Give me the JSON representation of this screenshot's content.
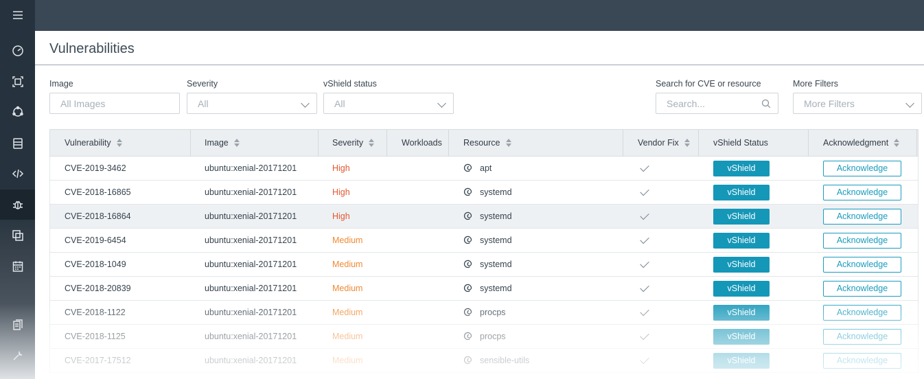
{
  "sidebar": {
    "items": [
      {
        "icon": "menu-icon"
      },
      {
        "icon": "dashboard-icon"
      },
      {
        "icon": "scan-icon"
      },
      {
        "icon": "cluster-icon"
      },
      {
        "icon": "database-icon"
      },
      {
        "icon": "code-icon"
      },
      {
        "icon": "bug-icon",
        "active": true
      },
      {
        "icon": "layers-icon"
      },
      {
        "icon": "calendar-icon"
      },
      {
        "icon": "report-icon"
      },
      {
        "icon": "wrench-icon"
      }
    ]
  },
  "page": {
    "title": "Vulnerabilities"
  },
  "filters": {
    "image": {
      "label": "Image",
      "placeholder": "All Images"
    },
    "severity": {
      "label": "Severity",
      "value": "All"
    },
    "vshield": {
      "label": "vShield status",
      "value": "All"
    },
    "search": {
      "label": "Search for CVE or resource",
      "placeholder": "Search..."
    },
    "more": {
      "label": "More Filters",
      "value": "More Filters"
    }
  },
  "table": {
    "columns": {
      "vulnerability": "Vulnerability",
      "image": "Image",
      "severity": "Severity",
      "workloads": "Workloads",
      "resource": "Resource",
      "vendor_fix": "Vendor Fix",
      "vshield_status": "vShield Status",
      "acknowledgment": "Acknowledgment"
    },
    "rows": [
      {
        "cve": "CVE-2019-3462",
        "image": "ubuntu:xenial-20171201",
        "severity": "High",
        "resource": "apt",
        "vshield": "vShield",
        "ack": "Acknowledge"
      },
      {
        "cve": "CVE-2018-16865",
        "image": "ubuntu:xenial-20171201",
        "severity": "High",
        "resource": "systemd",
        "vshield": "vShield",
        "ack": "Acknowledge"
      },
      {
        "cve": "CVE-2018-16864",
        "image": "ubuntu:xenial-20171201",
        "severity": "High",
        "resource": "systemd",
        "vshield": "vShield",
        "ack": "Acknowledge"
      },
      {
        "cve": "CVE-2019-6454",
        "image": "ubuntu:xenial-20171201",
        "severity": "Medium",
        "resource": "systemd",
        "vshield": "vShield",
        "ack": "Acknowledge"
      },
      {
        "cve": "CVE-2018-1049",
        "image": "ubuntu:xenial-20171201",
        "severity": "Medium",
        "resource": "systemd",
        "vshield": "vShield",
        "ack": "Acknowledge"
      },
      {
        "cve": "CVE-2018-20839",
        "image": "ubuntu:xenial-20171201",
        "severity": "Medium",
        "resource": "systemd",
        "vshield": "vShield",
        "ack": "Acknowledge"
      },
      {
        "cve": "CVE-2018-1122",
        "image": "ubuntu:xenial-20171201",
        "severity": "Medium",
        "resource": "procps",
        "vshield": "vShield",
        "ack": "Acknowledge"
      },
      {
        "cve": "CVE-2018-1125",
        "image": "ubuntu:xenial-20171201",
        "severity": "Medium",
        "resource": "procps",
        "vshield": "vShield",
        "ack": "Acknowledge"
      },
      {
        "cve": "CVE-2017-17512",
        "image": "ubuntu:xenial-20171201",
        "severity": "Medium",
        "resource": "sensible-utils",
        "vshield": "vShield",
        "ack": "Acknowledge"
      }
    ]
  },
  "colors": {
    "sidebar": "#26323d",
    "topbar": "#394854",
    "accent": "#1597b8",
    "severity_high": "#e4572e",
    "severity_medium": "#ef8a36"
  }
}
